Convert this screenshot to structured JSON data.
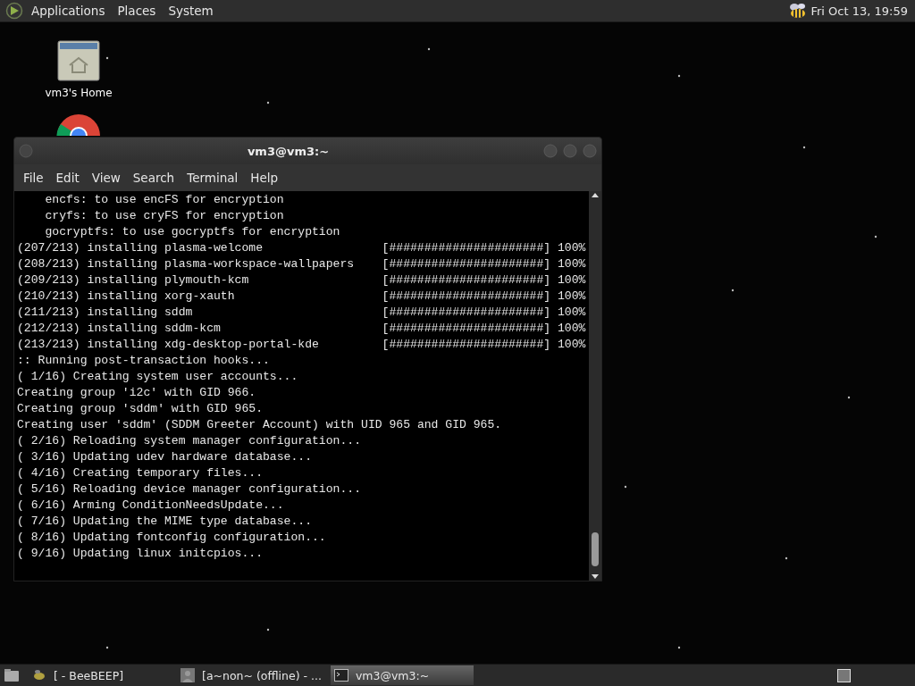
{
  "top_panel": {
    "menus": [
      "Applications",
      "Places",
      "System"
    ],
    "clock": "Fri Oct 13, 19:59"
  },
  "desktop": {
    "icons": [
      {
        "kind": "home",
        "label": "vm3's Home"
      },
      {
        "kind": "browser"
      }
    ]
  },
  "terminal": {
    "title": "vm3@vm3:~",
    "menu": [
      "File",
      "Edit",
      "View",
      "Search",
      "Terminal",
      "Help"
    ],
    "lines": [
      {
        "kind": "plain",
        "text": "    encfs: to use encFS for encryption"
      },
      {
        "kind": "plain",
        "text": "    cryfs: to use cryFS for encryption"
      },
      {
        "kind": "plain",
        "text": "    gocryptfs: to use gocryptfs for encryption"
      },
      {
        "kind": "progress",
        "text": "(207/213) installing plasma-welcome",
        "bar": "[######################]",
        "percent": "100%"
      },
      {
        "kind": "progress",
        "text": "(208/213) installing plasma-workspace-wallpapers",
        "bar": "[######################]",
        "percent": "100%"
      },
      {
        "kind": "progress",
        "text": "(209/213) installing plymouth-kcm",
        "bar": "[######################]",
        "percent": "100%"
      },
      {
        "kind": "progress",
        "text": "(210/213) installing xorg-xauth",
        "bar": "[######################]",
        "percent": "100%"
      },
      {
        "kind": "progress",
        "text": "(211/213) installing sddm",
        "bar": "[######################]",
        "percent": "100%"
      },
      {
        "kind": "progress",
        "text": "(212/213) installing sddm-kcm",
        "bar": "[######################]",
        "percent": "100%"
      },
      {
        "kind": "progress",
        "text": "(213/213) installing xdg-desktop-portal-kde",
        "bar": "[######################]",
        "percent": "100%"
      },
      {
        "kind": "plain",
        "text": ":: Running post-transaction hooks..."
      },
      {
        "kind": "plain",
        "text": "( 1/16) Creating system user accounts..."
      },
      {
        "kind": "plain",
        "text": "Creating group 'i2c' with GID 966."
      },
      {
        "kind": "plain",
        "text": "Creating group 'sddm' with GID 965."
      },
      {
        "kind": "plain",
        "text": "Creating user 'sddm' (SDDM Greeter Account) with UID 965 and GID 965."
      },
      {
        "kind": "plain",
        "text": "( 2/16) Reloading system manager configuration..."
      },
      {
        "kind": "plain",
        "text": "( 3/16) Updating udev hardware database..."
      },
      {
        "kind": "plain",
        "text": "( 4/16) Creating temporary files..."
      },
      {
        "kind": "plain",
        "text": "( 5/16) Reloading device manager configuration..."
      },
      {
        "kind": "plain",
        "text": "( 6/16) Arming ConditionNeedsUpdate..."
      },
      {
        "kind": "plain",
        "text": "( 7/16) Updating the MIME type database..."
      },
      {
        "kind": "plain",
        "text": "( 8/16) Updating fontconfig configuration..."
      },
      {
        "kind": "plain",
        "text": "( 9/16) Updating linux initcpios..."
      }
    ]
  },
  "taskbar": {
    "tasks": [
      {
        "kind": "bee",
        "label": "[ - BeeBEEP]",
        "selected": false
      },
      {
        "kind": "person",
        "label": "[a~non~ (offline) - ...",
        "selected": false
      },
      {
        "kind": "terminal",
        "label": "vm3@vm3:~",
        "selected": true
      }
    ]
  }
}
